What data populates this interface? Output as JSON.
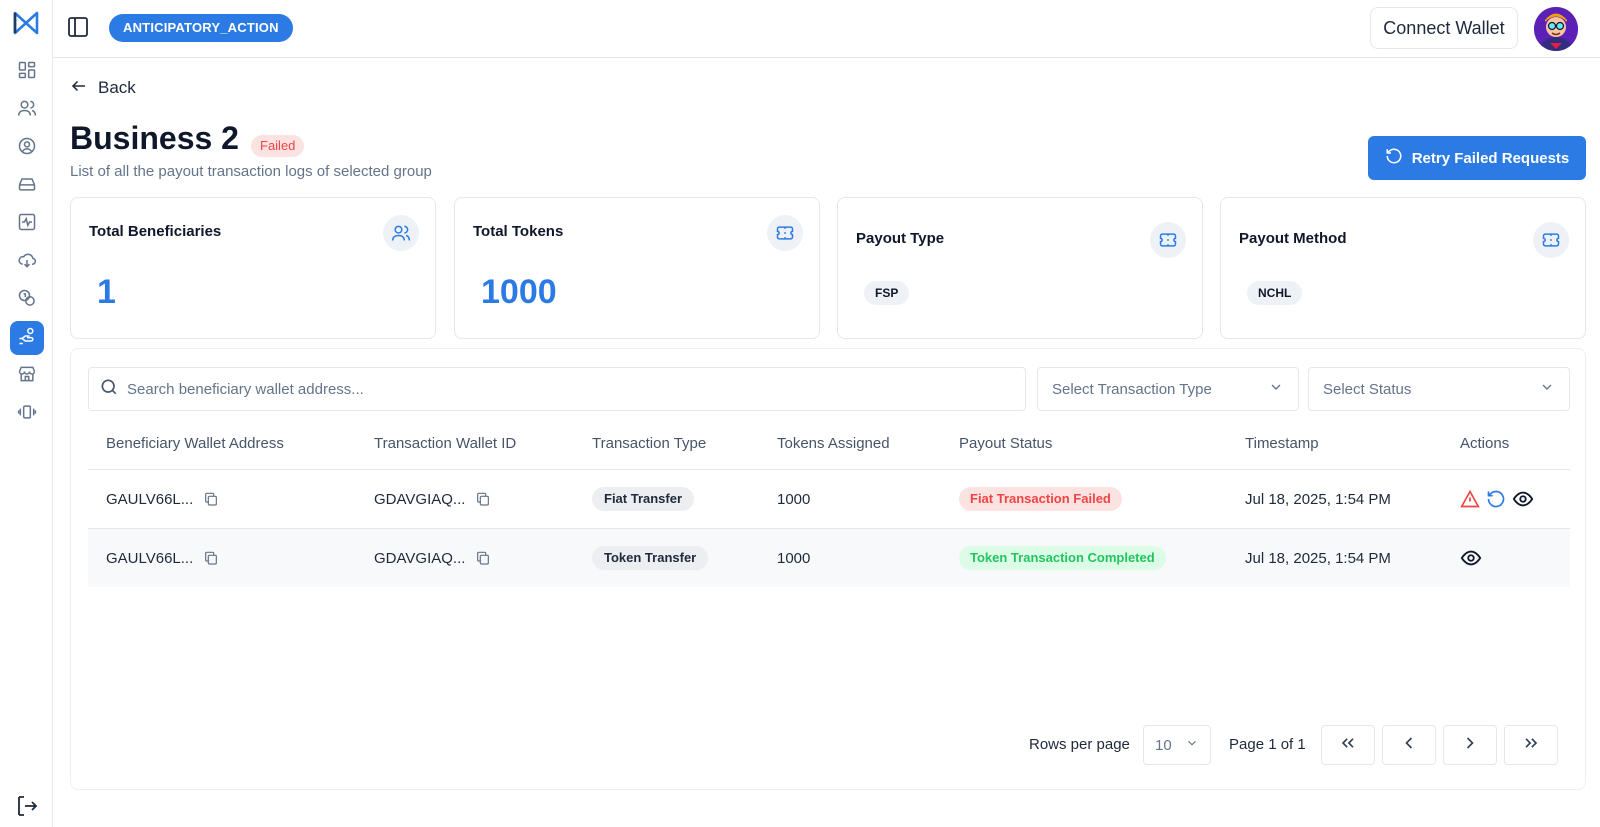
{
  "sidebar": {
    "logo": "rahat-logo-icon",
    "items": [
      {
        "icon": "dashboard-icon"
      },
      {
        "icon": "users-icon"
      },
      {
        "icon": "user-circle-icon"
      },
      {
        "icon": "hard-drive-icon"
      },
      {
        "icon": "activity-icon"
      },
      {
        "icon": "cloud-download-icon"
      },
      {
        "icon": "coins-icon"
      },
      {
        "icon": "hand-coins-icon",
        "active": true
      },
      {
        "icon": "store-icon"
      },
      {
        "icon": "vibrate-icon"
      }
    ],
    "logout_icon": "logout-icon"
  },
  "topbar": {
    "project": "ANTICIPATORY_ACTION",
    "connect_wallet": "Connect Wallet"
  },
  "page": {
    "back": "Back",
    "title": "Business 2",
    "status": "Failed",
    "subtitle": "List of all the payout transaction logs of selected group",
    "retry_button": "Retry Failed Requests"
  },
  "cards": {
    "beneficiaries": {
      "title": "Total Beneficiaries",
      "value": "1"
    },
    "tokens": {
      "title": "Total Tokens",
      "value": "1000"
    },
    "payout_type": {
      "title": "Payout Type",
      "value": "FSP"
    },
    "payout_method": {
      "title": "Payout Method",
      "value": "NCHL"
    }
  },
  "filters": {
    "search_placeholder": "Search beneficiary wallet address...",
    "transaction_type": "Select Transaction Type",
    "status": "Select Status"
  },
  "table": {
    "columns": [
      "Beneficiary Wallet Address",
      "Transaction Wallet ID",
      "Transaction Type",
      "Tokens Assigned",
      "Payout Status",
      "Timestamp",
      "Actions"
    ],
    "rows": [
      {
        "beneficiary": "GAULV66L...",
        "wallet_id": "GDAVGIAQ...",
        "type": "Fiat Transfer",
        "tokens": "1000",
        "status": "Fiat Transaction Failed",
        "timestamp": "Jul 18, 2025, 1:54 PM"
      },
      {
        "beneficiary": "GAULV66L...",
        "wallet_id": "GDAVGIAQ...",
        "type": "Token Transfer",
        "tokens": "1000",
        "status": "Token Transaction Completed",
        "timestamp": "Jul 18, 2025, 1:54 PM"
      }
    ]
  },
  "pagination": {
    "rows_per_page_label": "Rows per page",
    "rows_per_page": "10",
    "page_text": "Page 1 of 1"
  },
  "colors": {
    "accent": "#2c7be5",
    "failed": "#ef4444",
    "completed": "#22c55e"
  }
}
